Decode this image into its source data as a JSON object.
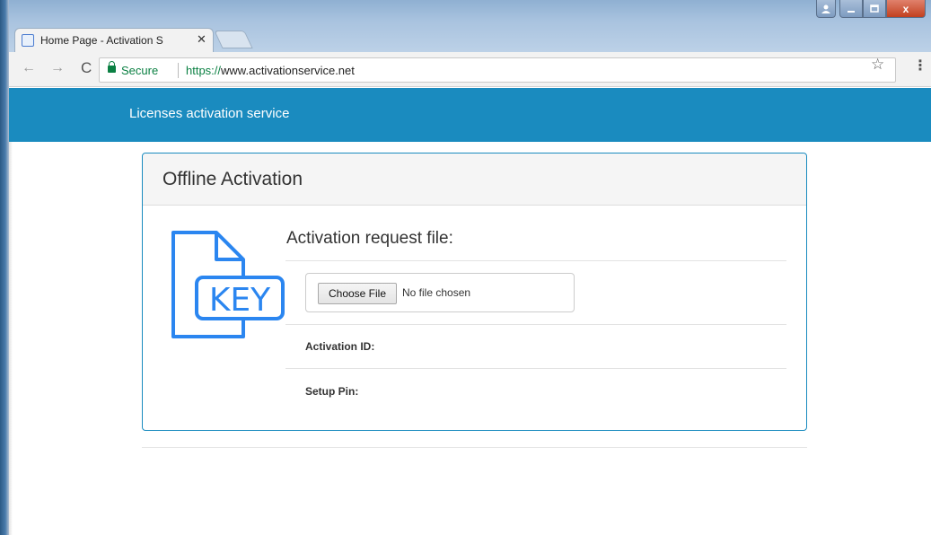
{
  "browser": {
    "tab_title": "Home Page - Activation S",
    "tab_close": "✕",
    "nav_back": "←",
    "nav_forward": "→",
    "nav_reload": "C",
    "secure_label": "Secure",
    "url_protocol": "https://",
    "url_host": "www.activationservice.net",
    "window_close": "x",
    "icons": [
      "back-arrow-icon",
      "forward-arrow-icon",
      "reload-icon",
      "lock-icon",
      "star-icon",
      "menu-icon"
    ]
  },
  "site": {
    "brand": "Licenses activation service",
    "header_color": "#1a8bbf"
  },
  "panel": {
    "title": "Offline Activation",
    "icon_text": "KEY",
    "section_title": "Activation request file:",
    "choose_file_label": "Choose File",
    "no_file_text": "No file chosen",
    "activation_id_label": "Activation ID:",
    "setup_pin_label": "Setup Pin:",
    "accent_color": "#2b86f0"
  }
}
